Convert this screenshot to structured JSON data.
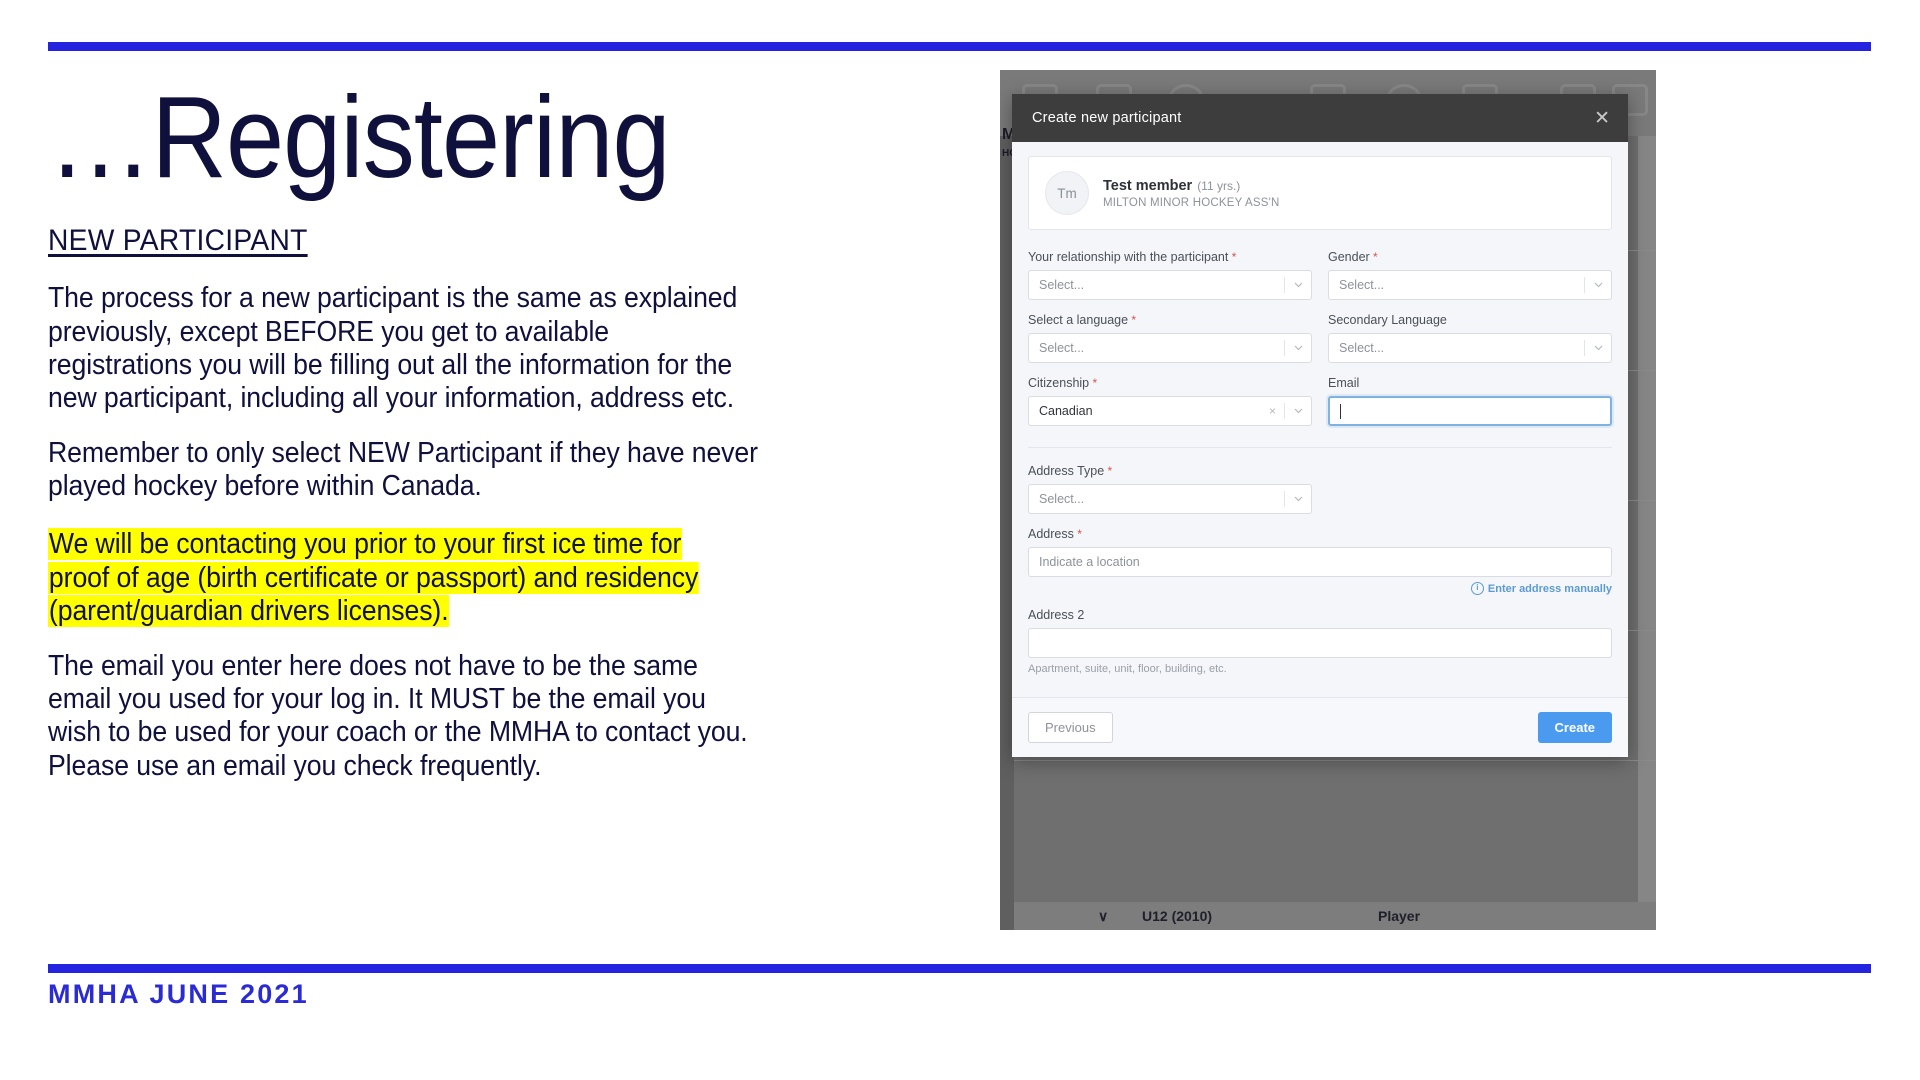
{
  "slide": {
    "title": "…Registering",
    "section_heading": "NEW PARTICIPANT",
    "paragraphs": [
      "The process for a new participant is the same as explained previously, except BEFORE you get to available registrations you will be filling out all the information for the new participant, including all your information, address etc.",
      "Remember to only select NEW Participant if they have never played hockey before within Canada."
    ],
    "highlighted_paragraph": "We will be contacting you prior to your first ice time for proof of age (birth certificate or passport) and residency (parent/guardian drivers licenses).",
    "closing_paragraph": "The email you enter here does not have to be the same email you used for your log in.   It MUST be the email you wish to be used for your coach or the MMHA to contact you. Please use an email you check frequently.",
    "footer": "MMHA JUNE 2021",
    "colors": {
      "rule": "#2323E0",
      "title_text": "#10103C",
      "footer_text": "#2B2BD6",
      "highlight": "#FFFF00"
    }
  },
  "screenshot": {
    "background": {
      "side_labels": [
        "M",
        "HO"
      ],
      "bottom_row": {
        "caret": "∨",
        "division": "U12 (2010)",
        "role": "Player"
      }
    },
    "modal": {
      "title": "Create new participant",
      "close_icon": "✕",
      "member": {
        "initials": "Tm",
        "name": "Test member",
        "age": "(11 yrs.)",
        "organization": "MILTON MINOR HOCKEY ASS'N"
      },
      "fields": [
        {
          "key": "relationship",
          "label": "Your relationship with the participant",
          "required": true,
          "type": "select",
          "value": "",
          "placeholder": "Select...",
          "clearable": false
        },
        {
          "key": "gender",
          "label": "Gender",
          "required": true,
          "type": "select",
          "value": "",
          "placeholder": "Select...",
          "clearable": false
        },
        {
          "key": "language",
          "label": "Select a language",
          "required": true,
          "type": "select",
          "value": "",
          "placeholder": "Select...",
          "clearable": false
        },
        {
          "key": "secondary_language",
          "label": "Secondary Language",
          "required": false,
          "type": "select",
          "value": "",
          "placeholder": "Select...",
          "clearable": false
        },
        {
          "key": "citizenship",
          "label": "Citizenship",
          "required": true,
          "type": "select",
          "value": "Canadian",
          "placeholder": "Select...",
          "clearable": true,
          "clear_icon": "×"
        },
        {
          "key": "email",
          "label": "Email",
          "required": false,
          "type": "text",
          "value": "",
          "placeholder": "",
          "focused": true
        },
        {
          "key": "address_type",
          "label": "Address Type",
          "required": true,
          "type": "select",
          "value": "",
          "placeholder": "Select...",
          "clearable": false
        },
        {
          "key": "address",
          "label": "Address",
          "required": true,
          "type": "text",
          "value": "",
          "placeholder": "Indicate a location"
        },
        {
          "key": "address2",
          "label": "Address 2",
          "required": false,
          "type": "text",
          "value": "",
          "placeholder": "",
          "helper": "Apartment, suite, unit, floor, building, etc."
        }
      ],
      "manual_address_link": "Enter address manually",
      "manual_address_icon": "i",
      "buttons": {
        "previous": "Previous",
        "create": "Create"
      },
      "accent_color": "#4A9BF0"
    }
  }
}
